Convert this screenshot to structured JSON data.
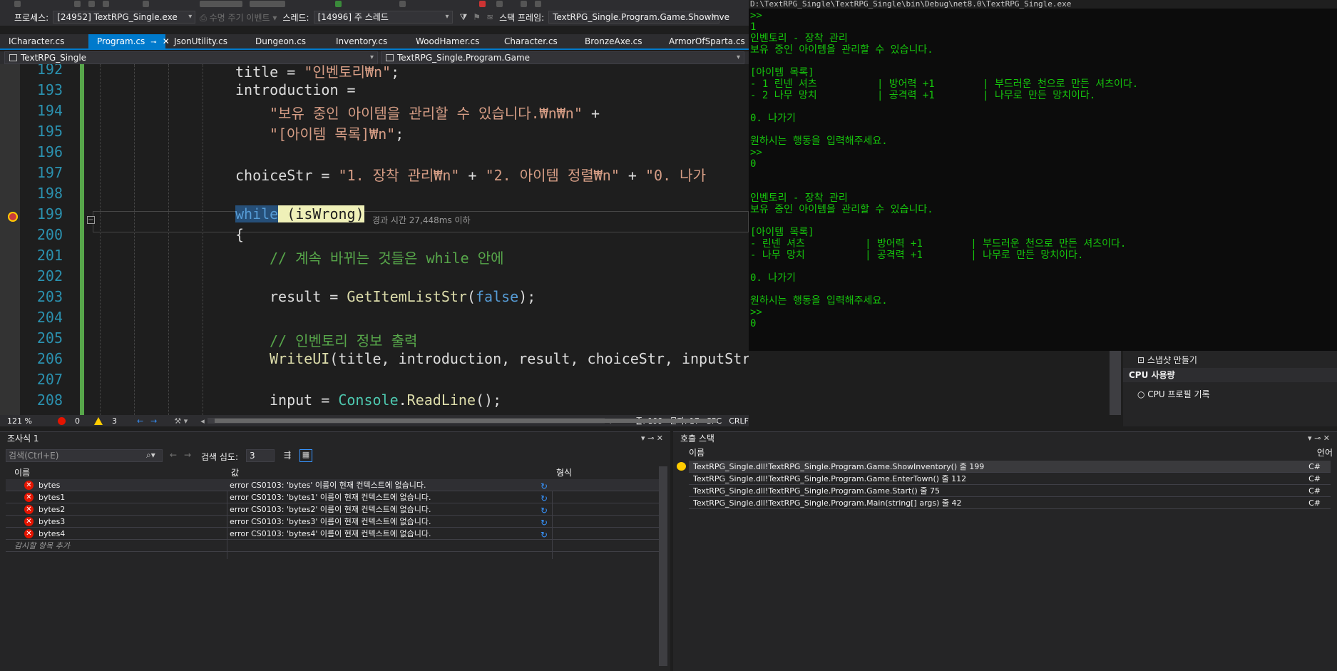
{
  "process_bar": {
    "process_label": "프로세스:",
    "process_value": "[24952] TextRPG_Single.exe",
    "lifecycle_label": "수명 주기 이벤트",
    "thread_label": "스레드:",
    "thread_value": "[14996] 주 스레드",
    "stackframe_label": "스택 프레임:",
    "stackframe_value": "TextRPG_Single.Program.Game.ShowInve"
  },
  "tabs": [
    {
      "label": "ICharacter.cs"
    },
    {
      "label": "Program.cs"
    },
    {
      "label": "JsonUtility.cs"
    },
    {
      "label": "Dungeon.cs"
    },
    {
      "label": "Inventory.cs"
    },
    {
      "label": "WoodHamer.cs"
    },
    {
      "label": "Character.cs"
    },
    {
      "label": "BronzeAxe.cs"
    },
    {
      "label": "ArmorOfSparta.cs"
    }
  ],
  "nav": {
    "project": "TextRPG_Single",
    "scope": "TextRPG_Single.Program.Game"
  },
  "editor": {
    "lines": [
      "192",
      "193",
      "194",
      "195",
      "196",
      "197",
      "198",
      "199",
      "200",
      "201",
      "202",
      "203",
      "204",
      "205",
      "206",
      "207",
      "208"
    ],
    "c192a": "title = ",
    "c192b": "\"인벤토리₩n\"",
    "c192c": ";",
    "c193": "introduction =",
    "c194a": "\"보유 중인 아이템을 관리할 수 있습니다.₩n₩n\"",
    "c194b": " +",
    "c195a": "\"[아이템 목록]₩n\"",
    "c195b": ";",
    "c197a": "choiceStr = ",
    "c197b": "\"1. 장착 관리₩n\"",
    "c197c": " + ",
    "c197d": "\"2. 아이템 정렬₩n\"",
    "c197e": " + ",
    "c197f": "\"0. 나가",
    "c199a": "while",
    "c199b": " (isWrong)",
    "c200": "{",
    "c201": "// 계속 바뀌는 것들은 while 안에",
    "c203a": "result = ",
    "c203b": "GetItemListStr",
    "c203c": "(",
    "c203d": "false",
    "c203e": ");",
    "c205": "// 인벤토리 정보 출력",
    "c206a": "WriteUI",
    "c206b": "(title, introduction, result, choiceStr, inputStr);",
    "c208a": "input = ",
    "c208b": "Console",
    "c208c": ".",
    "c208d": "ReadLine",
    "c208e": "();",
    "perf_tip": "경과 시간 27,448ms 이하"
  },
  "editor_status": {
    "zoom": "121 %",
    "errors": "0",
    "warnings": "3",
    "line": "줄: 199",
    "col": "문자: 17",
    "spc": "SPC",
    "crlf": "CRLF"
  },
  "console": {
    "title": "D:\\TextRPG_Single\\TextRPG_Single\\bin\\Debug\\net8.0\\TextRPG_Single.exe",
    "lines": [
      ">>",
      "1",
      "인벤토리 - 장착 관리",
      "보유 중인 아이템을 관리할 수 있습니다.",
      "",
      "[아이템 목록]",
      "- 1 린넨 셔츠          | 방어력 +1        | 부드러운 천으로 만든 셔츠이다.",
      "- 2 나무 망치          | 공격력 +1        | 나무로 만든 망치이다.",
      "",
      "0. 나가기",
      "",
      "원하시는 행동을 입력해주세요.",
      ">>",
      "0",
      "",
      "",
      "인벤토리 - 장착 관리",
      "보유 중인 아이템을 관리할 수 있습니다.",
      "",
      "[아이템 목록]",
      "- 린넨 셔츠          | 방어력 +1        | 부드러운 천으로 만든 셔츠이다.",
      "- 나무 망치          | 공격력 +1        | 나무로 만든 망치이다.",
      "",
      "0. 나가기",
      "",
      "원하시는 행동을 입력해주세요.",
      ">>",
      "0"
    ]
  },
  "diagnostics": {
    "snapshot": "스냅샷 만들기",
    "cpu_header": "CPU 사용량",
    "cpu_record": "CPU 프로필 기록"
  },
  "watch": {
    "title": "조사식 1",
    "search_placeholder": "검색(Ctrl+E)",
    "depth_label": "검색 심도:",
    "depth_value": "3",
    "col_name": "이름",
    "col_value": "값",
    "col_type": "형식",
    "rows": [
      {
        "name": "bytes",
        "value": "error CS0103: 'bytes' 이름이 현재 컨텍스트에 없습니다."
      },
      {
        "name": "bytes1",
        "value": "error CS0103: 'bytes1' 이름이 현재 컨텍스트에 없습니다."
      },
      {
        "name": "bytes2",
        "value": "error CS0103: 'bytes2' 이름이 현재 컨텍스트에 없습니다."
      },
      {
        "name": "bytes3",
        "value": "error CS0103: 'bytes3' 이름이 현재 컨텍스트에 없습니다."
      },
      {
        "name": "bytes4",
        "value": "error CS0103: 'bytes4' 이름이 현재 컨텍스트에 없습니다."
      }
    ],
    "add_item": "감시할 항목 추가"
  },
  "callstack": {
    "title": "호출 스택",
    "col_name": "이름",
    "col_lang": "언어",
    "rows": [
      {
        "name": "TextRPG_Single.dll!TextRPG_Single.Program.Game.ShowInventory() 줄 199",
        "lang": "C#"
      },
      {
        "name": "TextRPG_Single.dll!TextRPG_Single.Program.Game.EnterTown() 줄 112",
        "lang": "C#"
      },
      {
        "name": "TextRPG_Single.dll!TextRPG_Single.Program.Game.Start() 줄 75",
        "lang": "C#"
      },
      {
        "name": "TextRPG_Single.dll!TextRPG_Single.Program.Main(string[] args) 줄 42",
        "lang": "C#"
      }
    ]
  },
  "colors": {
    "accent": "#007acc",
    "console_text": "#16c60c",
    "error": "#e51400",
    "warning": "#ffcc00"
  }
}
